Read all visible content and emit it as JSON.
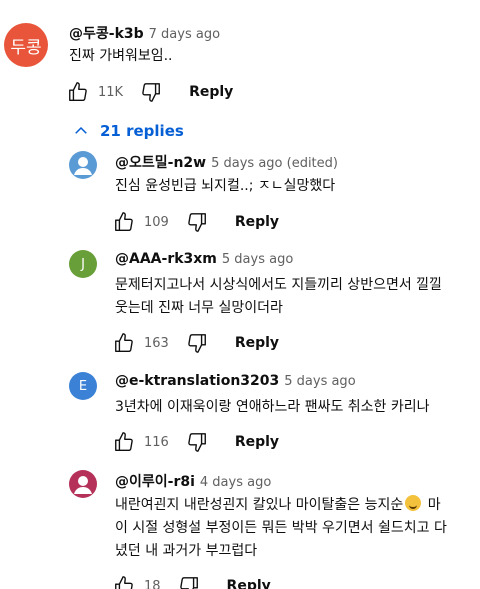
{
  "top_comment": {
    "avatar_text": "두콩",
    "handle": "@두콩-k3b",
    "time": "7 days ago",
    "text": "진짜 가벼워보임..",
    "likes": "11K",
    "reply_label": "Reply"
  },
  "replies_toggle": {
    "label": "21 replies"
  },
  "replies": [
    {
      "avatar_text": "",
      "avatar_color": "#5b9bd5",
      "handle": "@오트밀-n2w",
      "time": "5 days ago (edited)",
      "text_lines": [
        "진심 윤성빈급 뇌지컬..; ㅈㄴ실망했다"
      ],
      "likes": "109",
      "reply_label": "Reply"
    },
    {
      "avatar_text": "J",
      "avatar_color": "#689f38",
      "handle": "@AAA-rk3xm",
      "time": "5 days ago",
      "text_lines": [
        "문제터지고나서 시상식에서도 지들끼리 상반으면서 낄낄",
        "웃는데 진짜 너무 실망이더라"
      ],
      "likes": "163",
      "reply_label": "Reply"
    },
    {
      "avatar_text": "E",
      "avatar_color": "#3b82d6",
      "handle": "@e-ktranslation3203",
      "time": "5 days ago",
      "text_lines": [
        "3년차에 이재욱이랑 연애하느라 팬싸도 취소한 카리나"
      ],
      "likes": "116",
      "reply_label": "Reply"
    },
    {
      "avatar_text": "",
      "avatar_color": "#b5315a",
      "handle": "@이루이-r8i",
      "time": "4 days ago",
      "text_lines": [
        "내란여괸지 내란성괸지 칼있나 마이탈출은 능지순",
        "이 시절 성형설 부정이든 뭐든 박박 우기면서 쉴드치고 다",
        "녔던 내 과거가 부끄럽다"
      ],
      "emoji_after": "마",
      "likes": "18",
      "reply_label": "Reply"
    }
  ],
  "icons": {
    "like": "thumbs-up-icon",
    "dislike": "thumbs-down-icon",
    "collapse": "chevron-up-icon"
  }
}
